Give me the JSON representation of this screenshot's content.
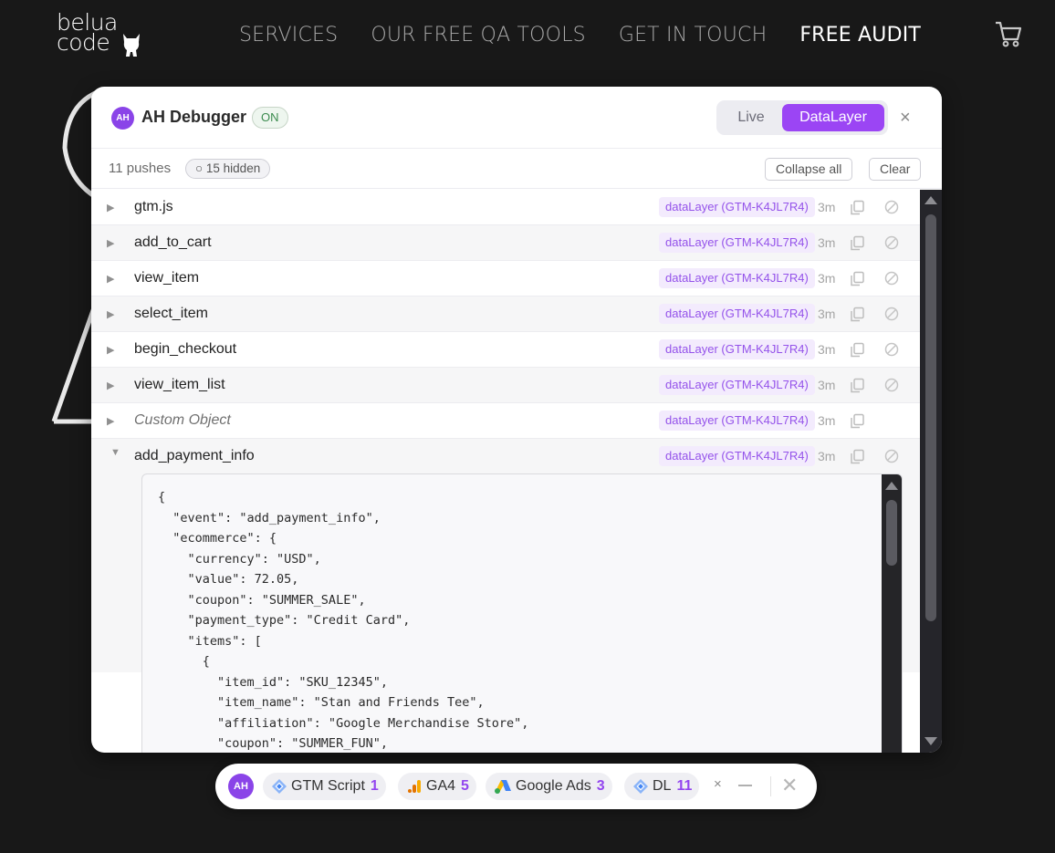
{
  "site": {
    "logo_line1": "belua",
    "logo_line2": "code",
    "nav": [
      {
        "label": "SERVICES"
      },
      {
        "label": "OUR FREE QA TOOLS"
      },
      {
        "label": "GET IN TOUCH"
      },
      {
        "label": "FREE AUDIT"
      }
    ]
  },
  "debugger": {
    "avatar": "AH",
    "title": "AH Debugger",
    "status": "ON",
    "modes": [
      "Live",
      "DataLayer"
    ],
    "active_mode": "DataLayer",
    "close": "×",
    "pushes_label": "11 pushes",
    "hidden_label": "○ 15 hidden",
    "collapse_all": "Collapse all",
    "clear": "Clear",
    "rows": [
      {
        "name": "gtm.js",
        "tag": "dataLayer (GTM-K4JL7R4)",
        "age": "3m"
      },
      {
        "name": "add_to_cart",
        "tag": "dataLayer (GTM-K4JL7R4)",
        "age": "3m"
      },
      {
        "name": "view_item",
        "tag": "dataLayer (GTM-K4JL7R4)",
        "age": "3m"
      },
      {
        "name": "select_item",
        "tag": "dataLayer (GTM-K4JL7R4)",
        "age": "3m"
      },
      {
        "name": "begin_checkout",
        "tag": "dataLayer (GTM-K4JL7R4)",
        "age": "3m"
      },
      {
        "name": "view_item_list",
        "tag": "dataLayer (GTM-K4JL7R4)",
        "age": "3m"
      },
      {
        "name": "Custom Object",
        "tag": "dataLayer (GTM-K4JL7R4)",
        "age": "3m"
      }
    ],
    "expanded_row": {
      "name": "add_payment_info",
      "tag": "dataLayer (GTM-K4JL7R4)",
      "age": "3m",
      "json": "{\n  \"event\": \"add_payment_info\",\n  \"ecommerce\": {\n    \"currency\": \"USD\",\n    \"value\": 72.05,\n    \"coupon\": \"SUMMER_SALE\",\n    \"payment_type\": \"Credit Card\",\n    \"items\": [\n      {\n        \"item_id\": \"SKU_12345\",\n        \"item_name\": \"Stan and Friends Tee\",\n        \"affiliation\": \"Google Merchandise Store\",\n        \"coupon\": \"SUMMER_FUN\","
    }
  },
  "bottom_bar": {
    "avatar": "AH",
    "chips": [
      {
        "label": "GTM Script",
        "count": "1",
        "icon": "gtm-icon"
      },
      {
        "label": "GA4",
        "count": "5",
        "icon": "ga4-icon"
      },
      {
        "label": "Google Ads",
        "count": "3",
        "icon": "google-ads-icon"
      },
      {
        "label": "DL",
        "count": "11",
        "icon": "datalayer-icon"
      }
    ],
    "x": "×",
    "close": "✕"
  },
  "colors": {
    "accent": "#9b45f4",
    "page_bg": "#181818",
    "tag_text": "#9452ea"
  }
}
